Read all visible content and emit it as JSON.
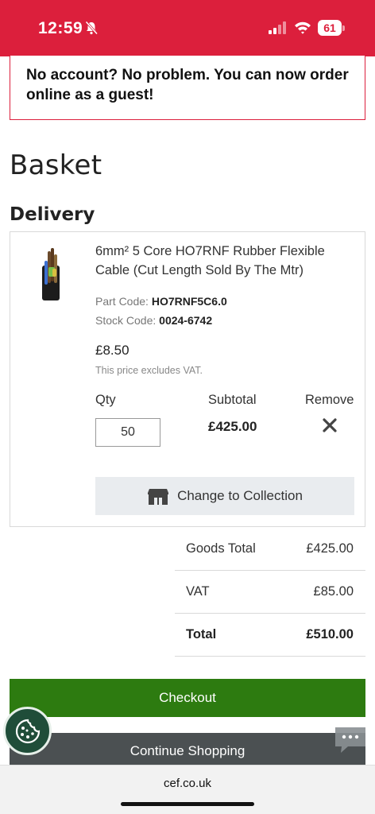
{
  "status_bar": {
    "time": "12:59",
    "battery": "61",
    "brand_color": "#dc1f3c",
    "icons": [
      "bell-off-icon",
      "signal-icon",
      "wifi-icon",
      "battery-icon"
    ]
  },
  "banner": {
    "text": "No account? No problem. You can now order online as a guest!"
  },
  "page": {
    "title": "Basket",
    "section": "Delivery"
  },
  "item": {
    "name": "6mm² 5 Core HO7RNF Rubber Flexible Cable (Cut Length Sold By The Mtr)",
    "part_code_label": "Part Code: ",
    "part_code": "HO7RNF5C6.0",
    "stock_code_label": "Stock Code: ",
    "stock_code": "0024-6742",
    "price": "£8.50",
    "vat_note": "This price excludes VAT.",
    "qty_label": "Qty",
    "qty_value": "50",
    "subtotal_label": "Subtotal",
    "subtotal_value": "£425.00",
    "remove_label": "Remove",
    "collection_button": "Change to Collection"
  },
  "totals": {
    "goods_label": "Goods Total",
    "goods_value": "£425.00",
    "vat_label": "VAT",
    "vat_value": "£85.00",
    "total_label": "Total",
    "total_value": "£510.00"
  },
  "actions": {
    "checkout": "Checkout",
    "checkout_color": "#2d7b10",
    "continue": "Continue Shopping"
  },
  "browser": {
    "url": "cef.co.uk"
  }
}
